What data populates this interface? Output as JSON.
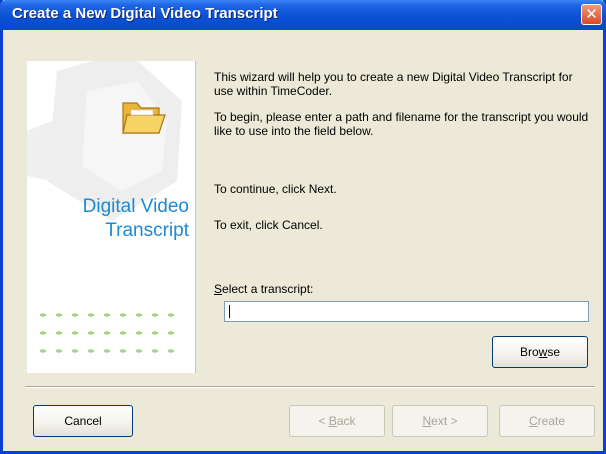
{
  "window": {
    "title": "Create a New Digital Video Transcript",
    "close_glyph": "✕"
  },
  "sidepanel": {
    "title_line1": "Digital Video",
    "title_line2": "Transcript",
    "icon": "folder-icon",
    "accent_color": "#1c8ad4",
    "dot_color": "#a8d48a"
  },
  "main": {
    "intro": "This wizard will help you to create a new Digital Video Transcript for use within TimeCoder.",
    "instruction": "To begin, please enter a path and filename for the transcript you would like to use into the field below.",
    "continue_text": "To continue, click Next.",
    "exit_text": "To exit, click Cancel.",
    "field_label_mnemonic": "S",
    "field_label_rest": "elect a transcript:",
    "field_value": ""
  },
  "buttons": {
    "browse_pre": "Bro",
    "browse_mnemonic": "w",
    "browse_post": "se",
    "cancel": "Cancel",
    "back_pre": "< ",
    "back_mnemonic": "B",
    "back_post": "ack",
    "next_mnemonic": "N",
    "next_post": "ext >",
    "create_mnemonic": "C",
    "create_post": "reate"
  }
}
